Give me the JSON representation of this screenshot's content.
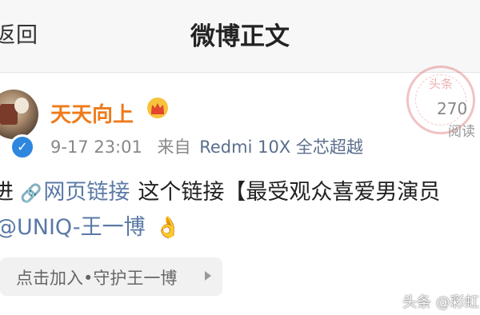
{
  "nav": {
    "back_label": "返回",
    "title": "微博正文"
  },
  "post": {
    "username": "天天向上",
    "time": "9-17 23:01",
    "from_label": "来自",
    "device": "Redmi 10X 全芯超越",
    "reads_count": "270",
    "reads_label": "阅读",
    "stamp_text": "头条",
    "line1_lead": "进",
    "link_text": "网页链接",
    "line1_rest": "这个链接【最受观众喜爱男演员",
    "mention": "@UNIQ-王一博",
    "emoji_name": "hand-icon",
    "supertopic_label": "点击加入•守护王一博"
  },
  "watermark": "头条 @彩虹"
}
